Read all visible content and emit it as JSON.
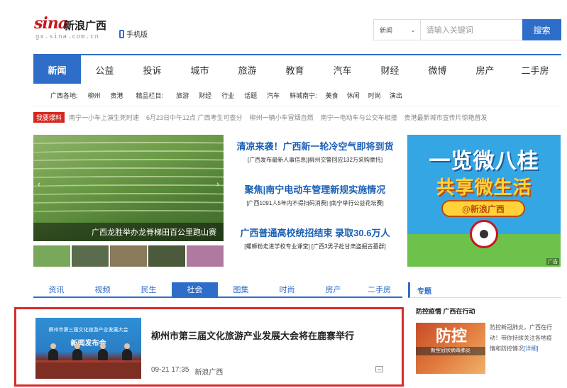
{
  "header": {
    "logo_sina": "sina",
    "logo_city": "新浪广西",
    "logo_domain": "gx.sina.com.cn",
    "mobile_label": "手机版",
    "search": {
      "category": "新闻",
      "placeholder": "请输入关键词",
      "button_label": "搜索"
    }
  },
  "nav": {
    "items": [
      "新闻",
      "公益",
      "投诉",
      "城市",
      "旅游",
      "教育",
      "汽车",
      "财经",
      "微博",
      "房产",
      "二手房"
    ]
  },
  "subnav": {
    "region_label": "广西各地:",
    "regions": [
      "柳州",
      "贵港"
    ],
    "columns_label": "精品栏目:",
    "columns": [
      "旅游",
      "财经",
      "行业",
      "话题",
      "汽车"
    ],
    "fresh_label": "鲜城南宁:",
    "fresh": [
      "美食",
      "休闲",
      "时尚",
      "演出"
    ]
  },
  "breaking": {
    "badge": "我要爆料",
    "items": [
      "南宁一小车上演生死时速",
      "6月23日中午12点 广西考生可查分",
      "柳州一辆小车冒烟自燃",
      "南宁一电动车与公交车相撞",
      "贵港最新城市宣传片惊艳首发"
    ]
  },
  "slideshow": {
    "caption": "广西龙胜举办龙脊梯田百公里跑山赛"
  },
  "headlines": [
    {
      "title": "清凉来袭！广西新一轮冷空气即将到货",
      "sub": "[广西发布最新人事信息][柳州交警回应132万采购摩托]"
    },
    {
      "title": "聚焦|南宁电动车管理新规实施情况",
      "sub": "[广西1091人5年内不得扫码消费] [南宁举行公益花坛赛]"
    },
    {
      "title": "广西普通高校统招结束 录取30.6万人",
      "sub": "[螺蛳粉走进学校专业课堂] [广西3男子赴甘肃盗掘古墓群]"
    }
  ],
  "ad": {
    "line1": "一览微八桂",
    "line2": "共享微生活",
    "pill": "@新浪广西",
    "tag": "广告"
  },
  "tabs": {
    "items": [
      "资讯",
      "视频",
      "民生",
      "社会",
      "图集",
      "时尚",
      "房产",
      "二手房"
    ],
    "active": "社会"
  },
  "feature": {
    "image_line1": "柳州市第三届文化旅游产业发展大会",
    "image_line2": "新闻发布会",
    "title": "柳州市第三届文化旅游产业发展大会将在鹿寨举行",
    "time": "09-21 17:35",
    "source": "新浪广西"
  },
  "topic": {
    "label": "专题",
    "title": "防控疫情 广西在行动",
    "image_big": "防控",
    "image_strip": "新型冠状病毒肺炎",
    "text": "防控新冠肺炎，广西在行动！带你持续关注各地疫情和防控情况",
    "more": "[详细]"
  },
  "colors": {
    "brand_blue": "#2e6ec9",
    "sina_red": "#c8161d",
    "highlight_border": "#d62d2d"
  }
}
